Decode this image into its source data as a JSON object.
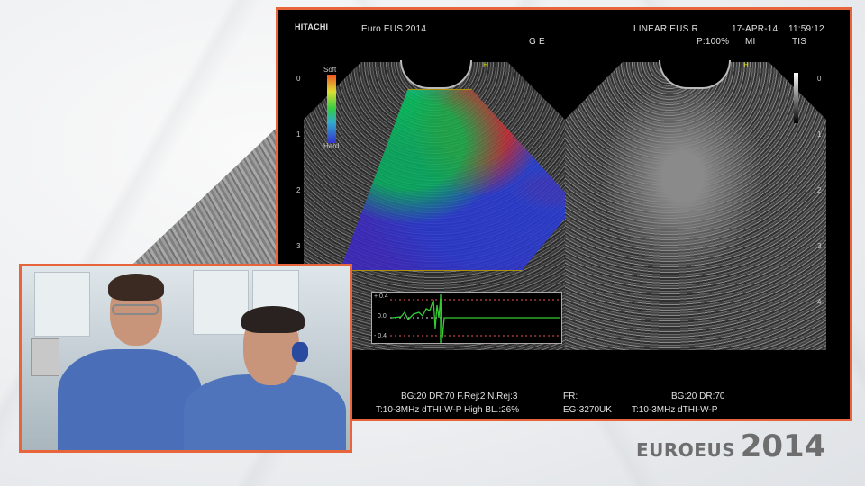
{
  "monitor": {
    "brand": "HITACHI",
    "exam_title": "Euro EUS 2014",
    "probe_label": "LINEAR EUS R",
    "date": "17-APR-14",
    "time": "11:59:12",
    "ge": "G E",
    "power": "P:100%",
    "mi": "MI",
    "tis": "TIS",
    "elasto_scale": {
      "soft": "Soft",
      "hard": "Hard"
    },
    "depth_ticks_left": [
      "0",
      "1",
      "2",
      "3"
    ],
    "depth_ticks_right": [
      "0",
      "1",
      "2",
      "3",
      "4"
    ],
    "graph_ticks": [
      "+ 0.4",
      "0.0",
      "- 0.4"
    ],
    "left_info_1": "BG:20   DR:70   F.Rej:2   N.Rej:3",
    "left_info_2": "T:10-3MHz     dTHI-W-P High    BL.:26%",
    "right_info_fr": "FR:",
    "right_info_model": "EG-3270UK",
    "right_info_1": "BG:20   DR:70",
    "right_info_2": "T:10-3MHz     dTHI-W-P",
    "marker": "H"
  },
  "logo": {
    "prefix": "EUROEUS",
    "year": "2014"
  },
  "colors": {
    "frame_orange": "#e8643a",
    "logo_gray": "#6e6e6e"
  }
}
